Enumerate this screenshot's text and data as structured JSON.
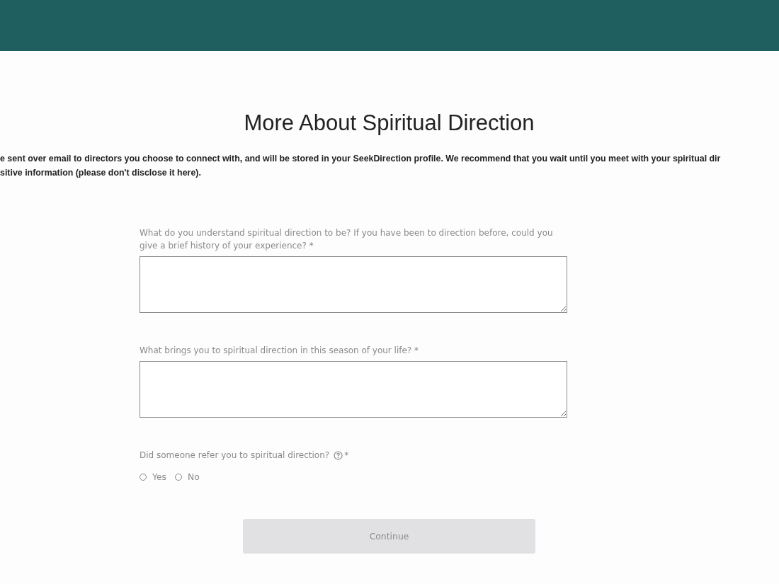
{
  "title": "More About Spiritual Direction",
  "intro_lines": [
    "e sent over email to directors you choose to connect with, and will be stored in your SeekDirection profile. We recommend that you wait until you meet with your spiritual dir",
    "sitive information (please don't disclose it here)."
  ],
  "questions": [
    {
      "kind": "textarea",
      "label": "What do you understand spiritual direction to be? If you have been to direction before, could you give a brief history of your experience?",
      "required_mark": "*"
    },
    {
      "kind": "textarea",
      "label": "What brings you to spiritual direction in this season of your life?",
      "required_mark": "*"
    },
    {
      "kind": "radio",
      "label": "Did someone refer you to spiritual direction?",
      "help": true,
      "required_mark": "*",
      "options": [
        {
          "label": "Yes",
          "selected": false
        },
        {
          "label": "No",
          "selected": false
        }
      ]
    }
  ],
  "continue_button": {
    "label": "Continue",
    "disabled": true
  }
}
